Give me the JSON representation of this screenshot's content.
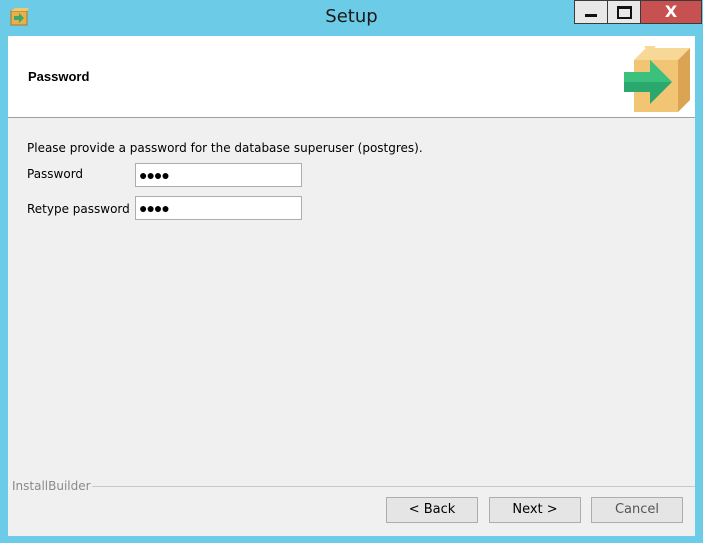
{
  "window": {
    "title": "Setup",
    "close_glyph": "X",
    "icon": "installer-box-icon"
  },
  "header": {
    "title": "Password",
    "icon": "installer-box-arrow-icon"
  },
  "form": {
    "prompt": "Please provide a password for the database superuser (postgres).",
    "password_label": "Password",
    "password_value": "●●●●",
    "retype_label": "Retype password",
    "retype_value": "●●●●"
  },
  "footer": {
    "group_label": "InstallBuilder",
    "back_label": "< Back",
    "next_label": "Next >",
    "cancel_label": "Cancel"
  },
  "colors": {
    "titlebar": "#6ccbe6",
    "close_button": "#c75050",
    "client_bg": "#f0f0f0",
    "header_bg": "#ffffff"
  }
}
